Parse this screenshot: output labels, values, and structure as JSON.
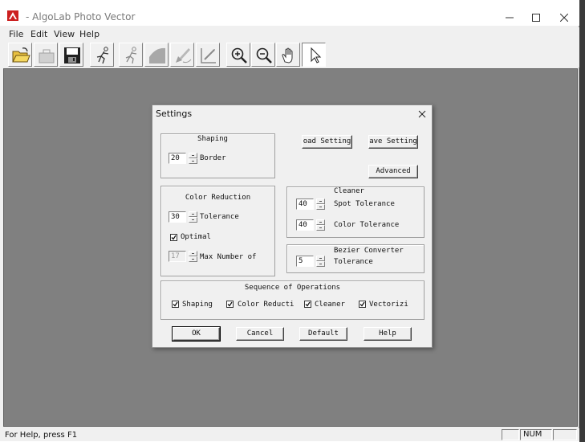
{
  "window": {
    "title": "- AlgoLab Photo Vector"
  },
  "titlebar_buttons": {
    "minimize_icon": "minimize-icon",
    "maximize_icon": "maximize-icon",
    "close_icon": "close-icon"
  },
  "menu": [
    "File",
    "Edit",
    "View",
    "Help"
  ],
  "toolbar": {
    "tools": [
      "open-folder-icon",
      "open-disabled-icon",
      "save-icon",
      "runner-icon",
      "runner-alt-icon",
      "shape-icon",
      "brush-icon",
      "pencil-icon",
      "zoom-in-icon",
      "zoom-out-icon",
      "hand-icon",
      "pointer-icon"
    ],
    "selected": "pointer-icon"
  },
  "status": {
    "help_text": "For Help, press F1",
    "num_indicator": "NUM"
  },
  "dialog": {
    "title": "Settings",
    "shaping": {
      "label": "Shaping",
      "border_value": "20",
      "border_label": "Border"
    },
    "color_reduction": {
      "label": "Color Reduction",
      "tolerance_value": "30",
      "tolerance_label": "Tolerance",
      "optimal_label": "Optimal",
      "optimal_checked": true,
      "max_value": "17",
      "max_label": "Max Number of"
    },
    "cleaner": {
      "label": "Cleaner",
      "spot_value": "40",
      "spot_label": "Spot Tolerance",
      "color_value": "40",
      "color_label": "Color Tolerance"
    },
    "bezier": {
      "label": "Bezier Converter",
      "tolerance_value": "5",
      "tolerance_label": "Tolerance"
    },
    "sequence": {
      "label": "Sequence of Operations",
      "items": [
        {
          "label": "Shaping",
          "checked": true
        },
        {
          "label": "Color Reducti",
          "checked": true
        },
        {
          "label": "Cleaner",
          "checked": true
        },
        {
          "label": "Vectorizi",
          "checked": true
        }
      ]
    },
    "buttons": {
      "load": "oad Setting",
      "save": "ave Setting",
      "advanced": "Advanced",
      "ok": "OK",
      "cancel": "Cancel",
      "default": "Default",
      "help": "Help"
    }
  }
}
